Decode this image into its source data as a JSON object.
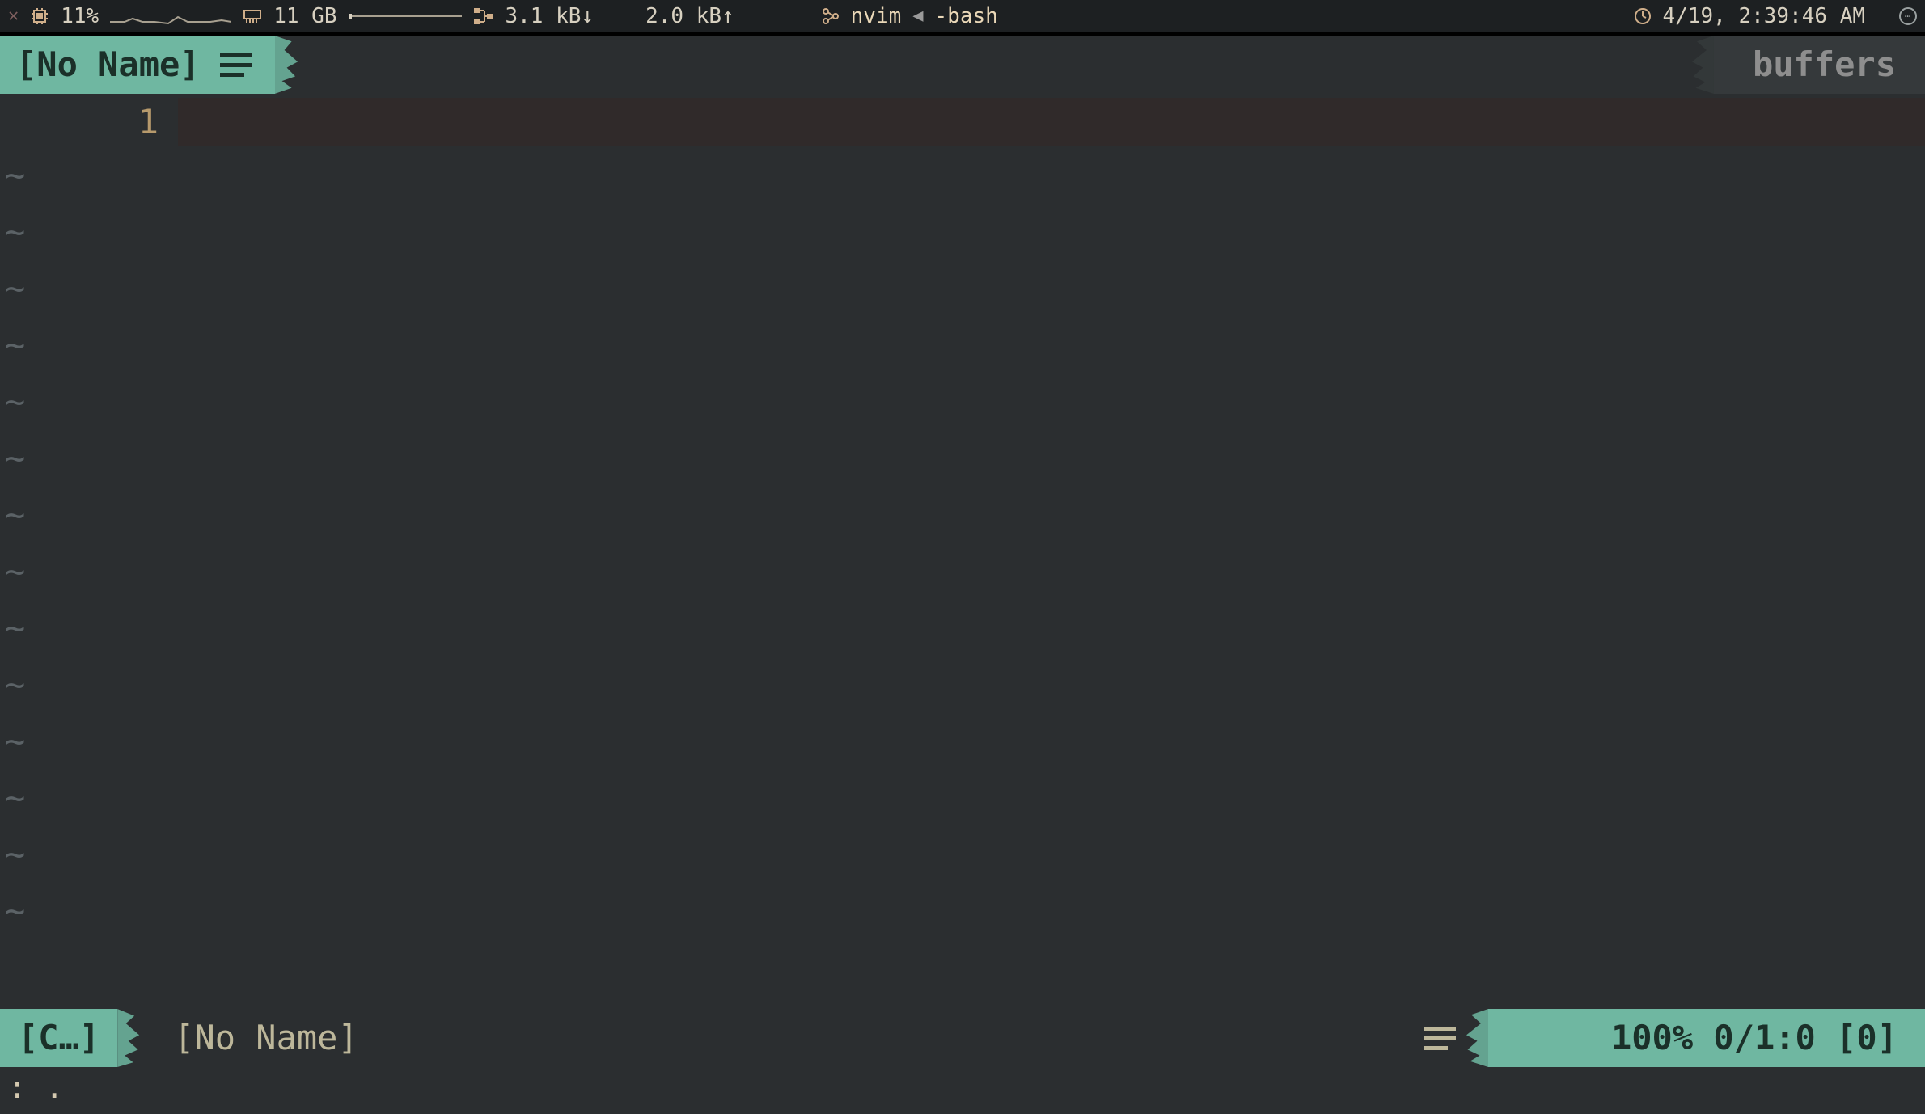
{
  "colors": {
    "bg": "#2b2e30",
    "accent": "#6fb7a1",
    "accent_fg": "#1b3029",
    "muted": "#8e8e8e",
    "gutter": "#b79a6c",
    "tilde": "#5b6266",
    "sysbar_bg": "#1d2022"
  },
  "sysbar": {
    "cpu_percent": "11%",
    "mem": "11 GB",
    "net_down": "3.1 kB",
    "net_up": "2.0 kB",
    "tmux_active": "nvim",
    "tmux_other": "-bash",
    "clock": "4/19, 2:39:46 AM"
  },
  "tabline": {
    "active_buffer": "[No Name]",
    "right_label": "buffers"
  },
  "buffer": {
    "current_line_number": "1",
    "tilde_rows": 14
  },
  "statusline": {
    "mode": "[C…]",
    "file": "[No Name]",
    "position": "100% 0/1:0 [0]"
  },
  "cmdline": {
    "text": ": ."
  }
}
